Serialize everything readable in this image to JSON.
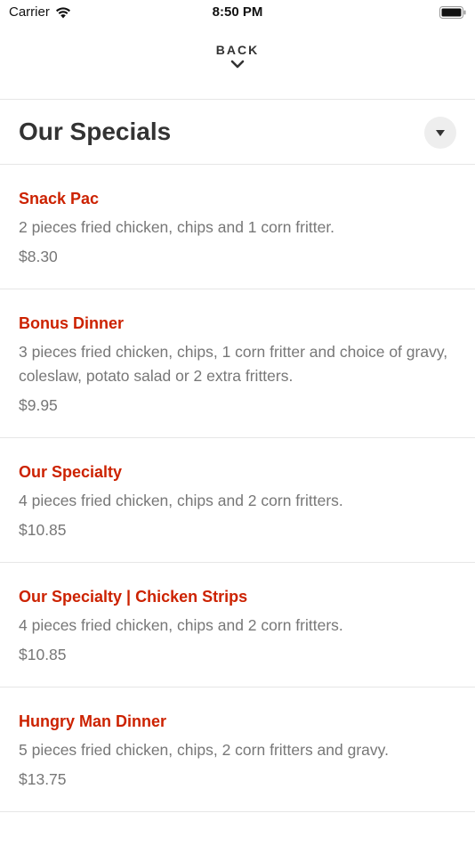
{
  "status": {
    "carrier": "Carrier",
    "time": "8:50 PM"
  },
  "nav": {
    "back_label": "BACK"
  },
  "section": {
    "title": "Our Specials"
  },
  "items": [
    {
      "name": "Snack Pac",
      "description": "2 pieces fried chicken, chips and 1 corn fritter.",
      "price": "$8.30"
    },
    {
      "name": "Bonus Dinner",
      "description": "3 pieces fried chicken, chips, 1 corn fritter and choice of gravy, coleslaw, potato salad or 2 extra fritters.",
      "price": "$9.95"
    },
    {
      "name": "Our Specialty",
      "description": "4 pieces fried chicken, chips and 2 corn fritters.",
      "price": "$10.85"
    },
    {
      "name": "Our Specialty | Chicken Strips",
      "description": "4 pieces fried chicken, chips and 2 corn fritters.",
      "price": "$10.85"
    },
    {
      "name": "Hungry Man Dinner",
      "description": "5 pieces fried chicken, chips, 2 corn fritters and gravy.",
      "price": "$13.75"
    }
  ],
  "colors": {
    "item_name": "#cc2200",
    "text_muted": "#777777",
    "divider": "#e6e6e6"
  }
}
